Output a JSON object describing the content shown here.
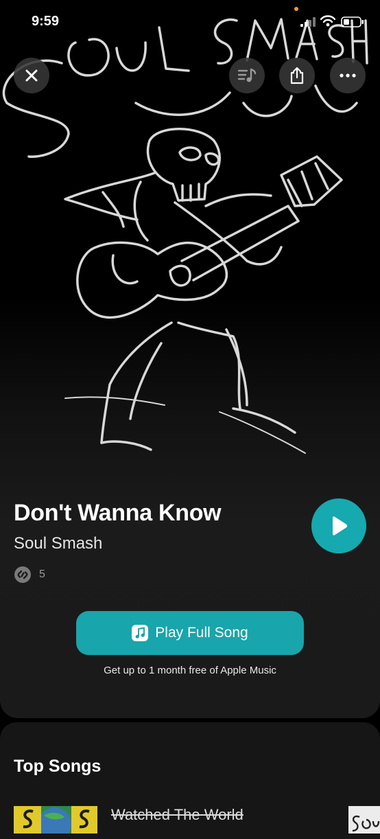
{
  "status": {
    "time": "9:59"
  },
  "song": {
    "title": "Don't Wanna Know",
    "artist": "Soul Smash",
    "shazam_count": "5"
  },
  "actions": {
    "play_full_label": "Play Full Song",
    "promo": "Get up to 1 month free of Apple Music"
  },
  "top_songs": {
    "heading": "Top Songs",
    "first_item_title": "Watched The World"
  },
  "colors": {
    "accent": "#16a9b0",
    "button": "#18a5ab",
    "background": "#000000"
  },
  "icons": [
    "close-icon",
    "lyrics-note-icon",
    "share-icon",
    "more-icon",
    "play-icon",
    "music-note-icon",
    "shazam-icon"
  ]
}
